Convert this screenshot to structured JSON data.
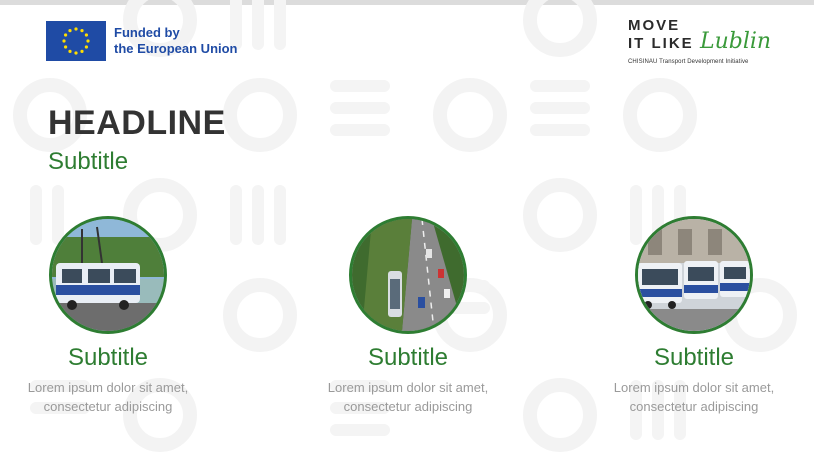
{
  "eu_label": {
    "line1": "Funded by",
    "line2": "the European Union"
  },
  "logo": {
    "line1": "MOVE",
    "line2": "IT LIKE",
    "script": "Lublin",
    "tagline": "CHISINAU Transport Development Initiative"
  },
  "headline": "HEADLINE",
  "subtitle": "Subtitle",
  "cards": [
    {
      "title": "Subtitle",
      "text1": "Lorem ipsum dolor sit amet,",
      "text2": "consectetur adipiscing",
      "photo_icon": "trolleybus-street-photo"
    },
    {
      "title": "Subtitle",
      "text1": "Lorem ipsum dolor sit amet,",
      "text2": "consectetur adipiscing",
      "photo_icon": "aerial-road-photo"
    },
    {
      "title": "Subtitle",
      "text1": "Lorem ipsum dolor sit amet,",
      "text2": "consectetur adipiscing",
      "photo_icon": "trolleybus-depot-photo"
    }
  ],
  "colors": {
    "green": "#2e7d32",
    "eu_blue": "#1f4ba5",
    "headline": "#333333",
    "body_text": "#9a9a9a"
  }
}
